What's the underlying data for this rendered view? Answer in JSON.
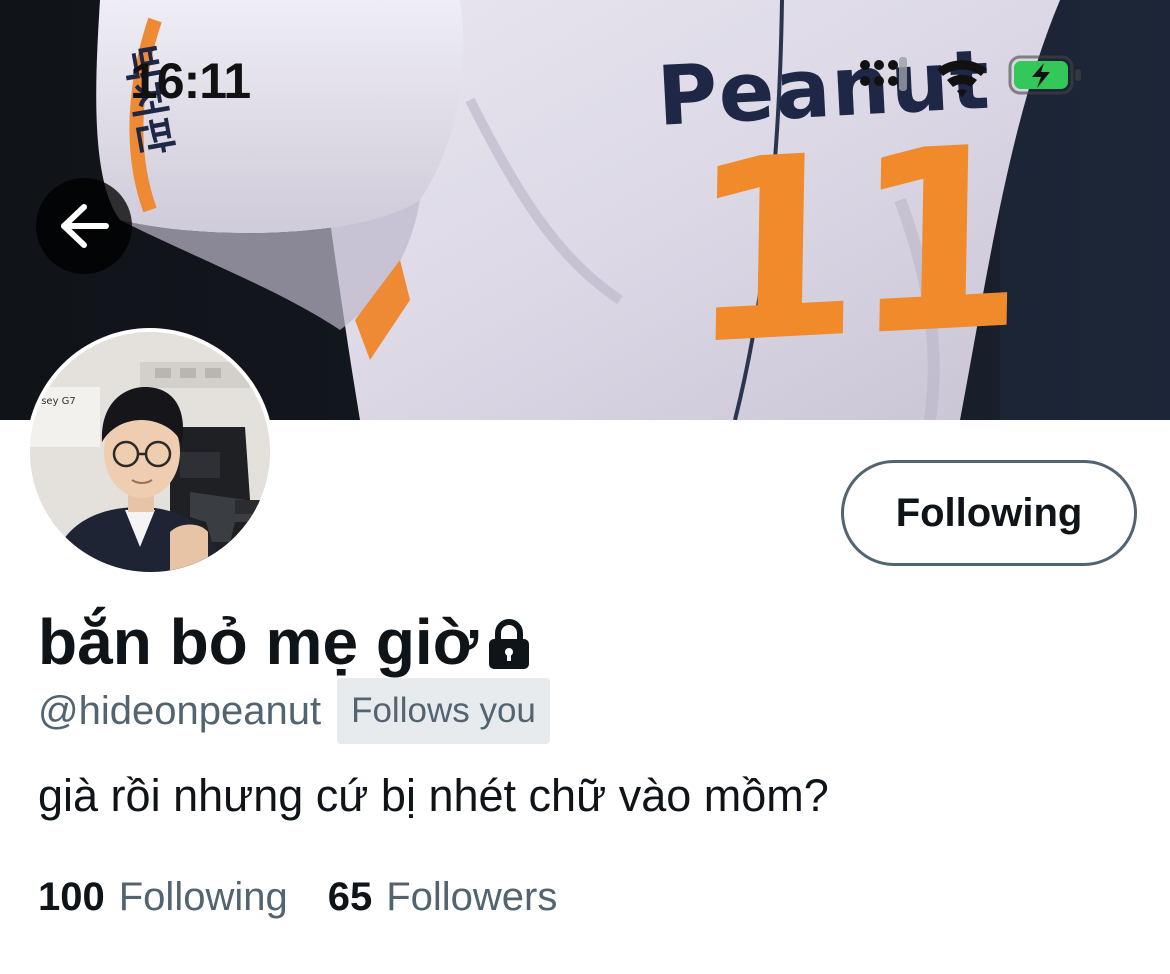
{
  "status_bar": {
    "time": "16:11"
  },
  "banner": {
    "jersey_name": "Peanut",
    "jersey_number": "11",
    "sleeve_text": "빅처판"
  },
  "profile": {
    "following_button_label": "Following",
    "display_name": "bắn bỏ mẹ giờ",
    "handle": "@hideonpeanut",
    "follows_you_badge": "Follows you",
    "bio": "già rồi nhưng cứ bị nhét chữ vào mồm?",
    "stats": {
      "following_count": "100",
      "following_label": "Following",
      "followers_count": "65",
      "followers_label": "Followers"
    }
  },
  "icons": {
    "back": "arrow-left-icon",
    "lock": "lock-icon",
    "signal": "cellular-signal-icon",
    "wifi": "wifi-icon",
    "battery": "battery-charging-icon"
  },
  "colors": {
    "text_primary": "#0f1419",
    "text_secondary": "#536471",
    "badge_bg": "#e7ebee",
    "jersey_orange": "#f08a2a",
    "jersey_navy": "#1e2745",
    "battery_green": "#34c759"
  }
}
